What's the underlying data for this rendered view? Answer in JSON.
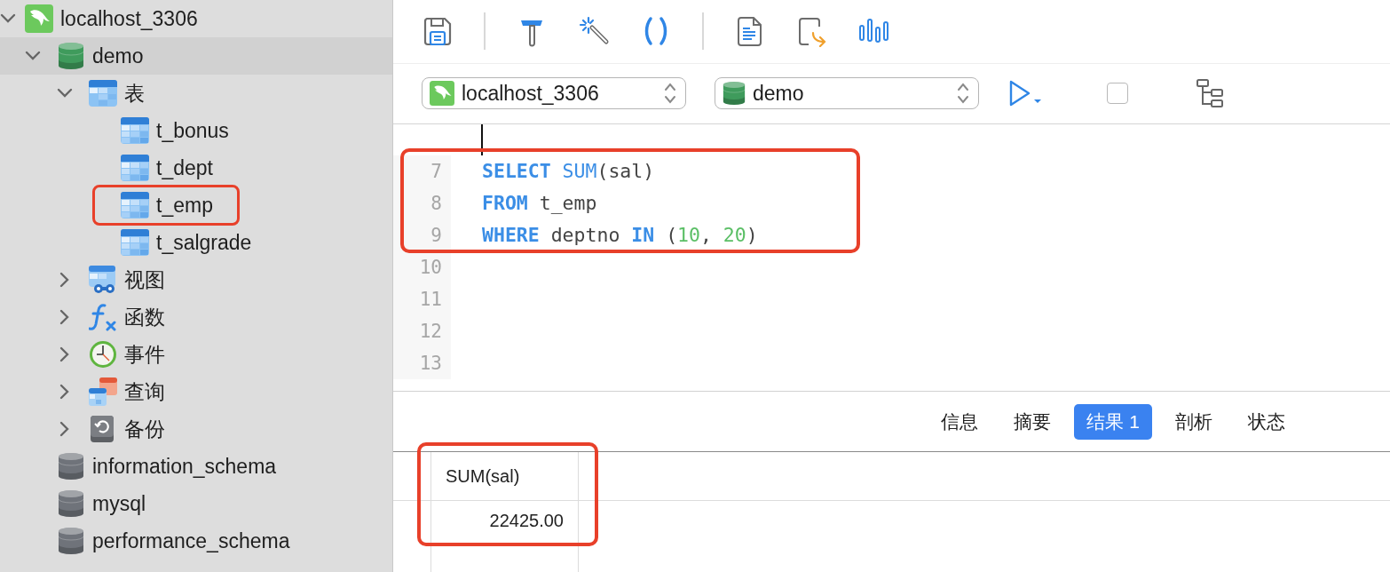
{
  "sidebar": {
    "tree": [
      {
        "label": "localhost_3306",
        "kind": "server",
        "expanded": true,
        "selected": false,
        "highlighted": false,
        "children": [
          {
            "label": "demo",
            "kind": "database",
            "color": "#3f9b5c",
            "expanded": true,
            "selected": true,
            "highlighted": false,
            "children": [
              {
                "label": "表",
                "kind": "tables",
                "expanded": true,
                "selected": false,
                "highlighted": false,
                "children": [
                  {
                    "label": "t_bonus",
                    "kind": "table",
                    "selected": false,
                    "highlighted": false
                  },
                  {
                    "label": "t_dept",
                    "kind": "table",
                    "selected": false,
                    "highlighted": false
                  },
                  {
                    "label": "t_emp",
                    "kind": "table",
                    "selected": false,
                    "highlighted": true
                  },
                  {
                    "label": "t_salgrade",
                    "kind": "table",
                    "selected": false,
                    "highlighted": false
                  }
                ]
              },
              {
                "label": "视图",
                "kind": "views",
                "expanded": false,
                "selected": false,
                "highlighted": false
              },
              {
                "label": "函数",
                "kind": "functions",
                "expanded": false,
                "selected": false,
                "highlighted": false
              },
              {
                "label": "事件",
                "kind": "events",
                "expanded": false,
                "selected": false,
                "highlighted": false
              },
              {
                "label": "查询",
                "kind": "queries",
                "expanded": false,
                "selected": false,
                "highlighted": false
              },
              {
                "label": "备份",
                "kind": "backups",
                "expanded": false,
                "selected": false,
                "highlighted": false
              }
            ]
          },
          {
            "label": "information_schema",
            "kind": "database",
            "color": "#6f737a",
            "selected": false,
            "highlighted": false
          },
          {
            "label": "mysql",
            "kind": "database",
            "color": "#6f737a",
            "selected": false,
            "highlighted": false
          },
          {
            "label": "performance_schema",
            "kind": "database",
            "color": "#6f737a",
            "selected": false,
            "highlighted": false
          }
        ]
      }
    ]
  },
  "connection_bar": {
    "connection": "localhost_3306",
    "database": "demo"
  },
  "editor": {
    "highlighted": true,
    "lines": [
      {
        "number": "7",
        "tokens": [
          {
            "kind": "keyword",
            "text": "SELECT"
          },
          {
            "kind": "function",
            "text": " SUM"
          },
          {
            "kind": "text",
            "text": "(sal)"
          }
        ]
      },
      {
        "number": "8",
        "tokens": [
          {
            "kind": "keyword",
            "text": "FROM"
          },
          {
            "kind": "text",
            "text": " t_emp"
          }
        ]
      },
      {
        "number": "9",
        "tokens": [
          {
            "kind": "keyword",
            "text": "WHERE"
          },
          {
            "kind": "text",
            "text": " deptno "
          },
          {
            "kind": "keyword",
            "text": "IN"
          },
          {
            "kind": "text",
            "text": " ("
          },
          {
            "kind": "number",
            "text": "10"
          },
          {
            "kind": "text",
            "text": ", "
          },
          {
            "kind": "number",
            "text": "20"
          },
          {
            "kind": "text",
            "text": ")"
          }
        ]
      },
      {
        "number": "10"
      },
      {
        "number": "11"
      },
      {
        "number": "12"
      },
      {
        "number": "13"
      }
    ]
  },
  "result_tabs": [
    {
      "label": "信息",
      "selected": false
    },
    {
      "label": "摘要",
      "selected": false
    },
    {
      "label": "结果 1",
      "selected": true
    },
    {
      "label": "剖析",
      "selected": false
    },
    {
      "label": "状态",
      "selected": false
    }
  ],
  "result_grid": {
    "highlighted": true,
    "columns": [
      "SUM(sal)"
    ],
    "rows": [
      [
        "22425.00"
      ]
    ]
  }
}
